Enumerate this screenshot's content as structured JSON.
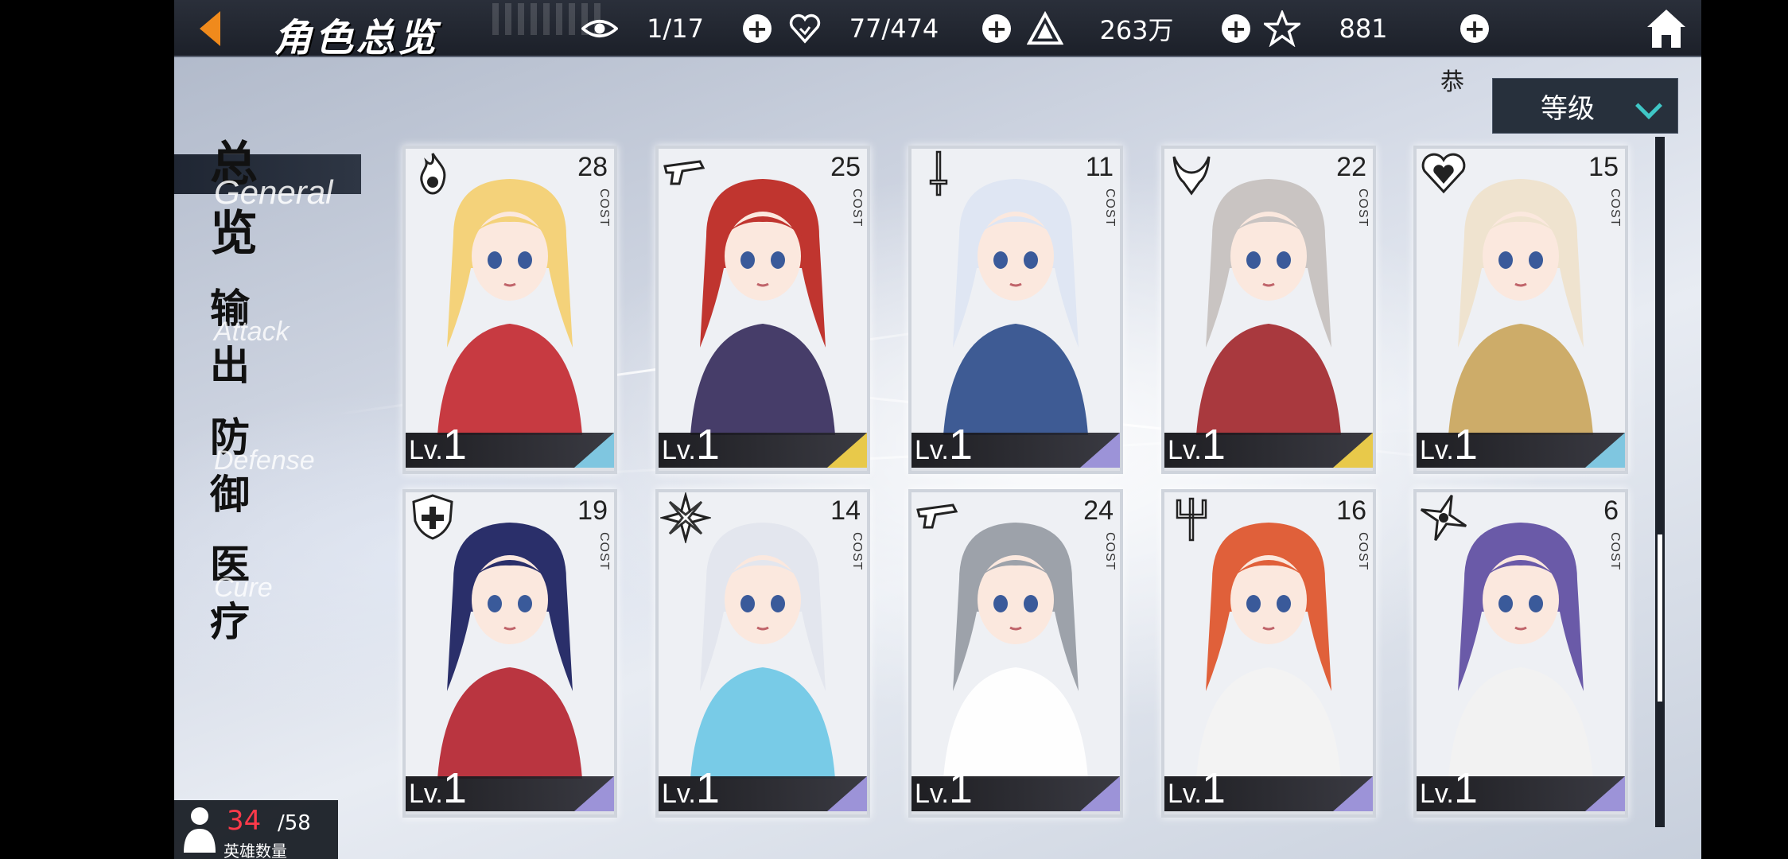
{
  "header": {
    "title": "角色总览",
    "resources": [
      {
        "icon": "eye-icon",
        "value": "1/17"
      },
      {
        "icon": "heart-icon",
        "value": "77/474"
      },
      {
        "icon": "triangle-crystal-icon",
        "value": "263万"
      },
      {
        "icon": "star-icon",
        "value": "881"
      }
    ]
  },
  "notice_char": "恭",
  "sort": {
    "label": "等级"
  },
  "nav": [
    {
      "zh": "总览",
      "en": "General",
      "active": true
    },
    {
      "zh": "输出",
      "en": "Attack"
    },
    {
      "zh": "防御",
      "en": "Defense"
    },
    {
      "zh": "医疗",
      "en": "Cure"
    }
  ],
  "cards": [
    {
      "cost": "28",
      "class_icon": "fire-icon",
      "level_prefix": "Lv.",
      "level": "1",
      "rarity_color": "#7fc6e0",
      "hair": "#f4d27a",
      "outfit": "#c2262e"
    },
    {
      "cost": "25",
      "class_icon": "gun-icon",
      "level_prefix": "Lv.",
      "level": "1",
      "rarity_color": "#e8c94a",
      "hair": "#c0352f",
      "outfit": "#33295a"
    },
    {
      "cost": "11",
      "class_icon": "sword-icon",
      "level_prefix": "Lv.",
      "level": "1",
      "rarity_color": "#9c93d8",
      "hair": "#dfe6f3",
      "outfit": "#2a4a8a"
    },
    {
      "cost": "22",
      "class_icon": "demon-icon",
      "level_prefix": "Lv.",
      "level": "1",
      "rarity_color": "#e8c94a",
      "hair": "#c9c4c2",
      "outfit": "#a1252a"
    },
    {
      "cost": "15",
      "class_icon": "heart-class-icon",
      "level_prefix": "Lv.",
      "level": "1",
      "rarity_color": "#7fc6e0",
      "hair": "#efe3cf",
      "outfit": "#c9a45a"
    },
    {
      "cost": "19",
      "class_icon": "shield-icon",
      "level_prefix": "Lv.",
      "level": "1",
      "rarity_color": "#9c93d8",
      "hair": "#2a2f6a",
      "outfit": "#b4202c"
    },
    {
      "cost": "14",
      "class_icon": "snowflake-icon",
      "level_prefix": "Lv.",
      "level": "1",
      "rarity_color": "#9c93d8",
      "hair": "#e3e6ee",
      "outfit": "#6ac6e6"
    },
    {
      "cost": "24",
      "class_icon": "gun-icon",
      "level_prefix": "Lv.",
      "level": "1",
      "rarity_color": "#9c93d8",
      "hair": "#9da2aa",
      "outfit": "#ffffff"
    },
    {
      "cost": "16",
      "class_icon": "trident-icon",
      "level_prefix": "Lv.",
      "level": "1",
      "rarity_color": "#9c93d8",
      "hair": "#e0603a",
      "outfit": "#f3f3f3"
    },
    {
      "cost": "6",
      "class_icon": "shuriken-icon",
      "level_prefix": "Lv.",
      "level": "1",
      "rarity_color": "#9c93d8",
      "hair": "#6a5aa8",
      "outfit": "#f2f2f2"
    }
  ],
  "cost_label": "COST",
  "hero_count": {
    "current": "34",
    "max": "/58",
    "label": "英雄数量"
  }
}
